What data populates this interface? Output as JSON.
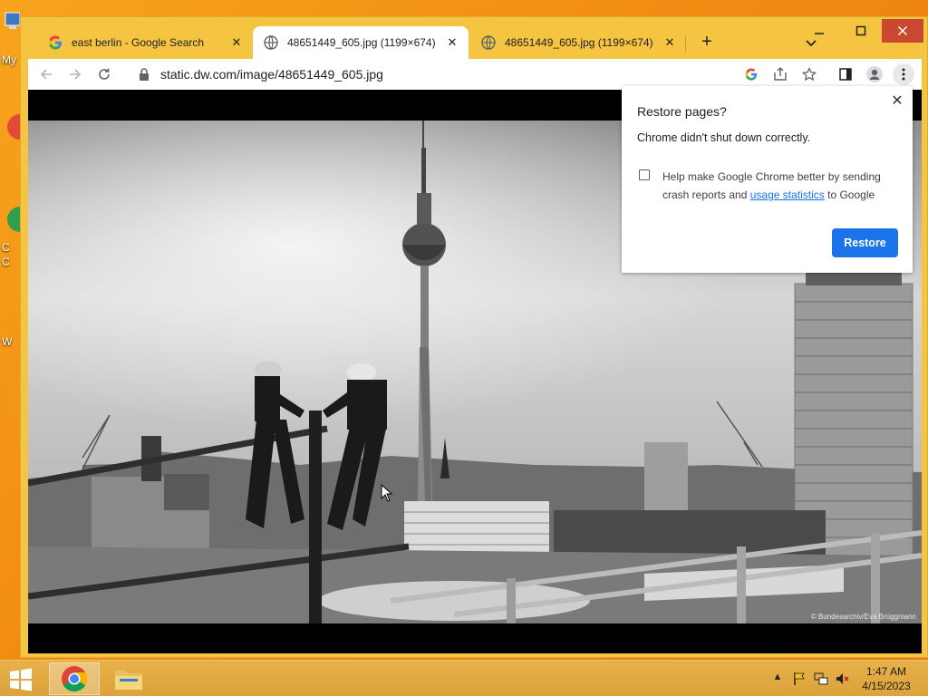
{
  "desktop": {
    "labels": [
      "My",
      "C",
      "C",
      "W"
    ]
  },
  "browser": {
    "tabs": [
      {
        "title": "east berlin - Google Search",
        "icon": "google-icon",
        "active": false
      },
      {
        "title": "48651449_605.jpg (1199×674)",
        "icon": "globe-icon",
        "active": true
      },
      {
        "title": "48651449_605.jpg (1199×674)",
        "icon": "globe-icon",
        "active": false
      }
    ],
    "address": {
      "url": "static.dw.com/image/48651449_605.jpg"
    }
  },
  "image": {
    "credit": "© Bundesarchiv/Eva Brüggmann"
  },
  "popup": {
    "title": "Restore pages?",
    "message": "Chrome didn't shut down correctly.",
    "checkbox_text_before": "Help make Google Chrome better by sending crash reports and",
    "checkbox_link": "usage statistics",
    "checkbox_text_after": "to Google",
    "checkbox_checked": false,
    "restore_label": "Restore",
    "accent_color": "#1a73e8"
  },
  "taskbar": {
    "time": "1:47 AM",
    "date": "4/15/2023"
  }
}
